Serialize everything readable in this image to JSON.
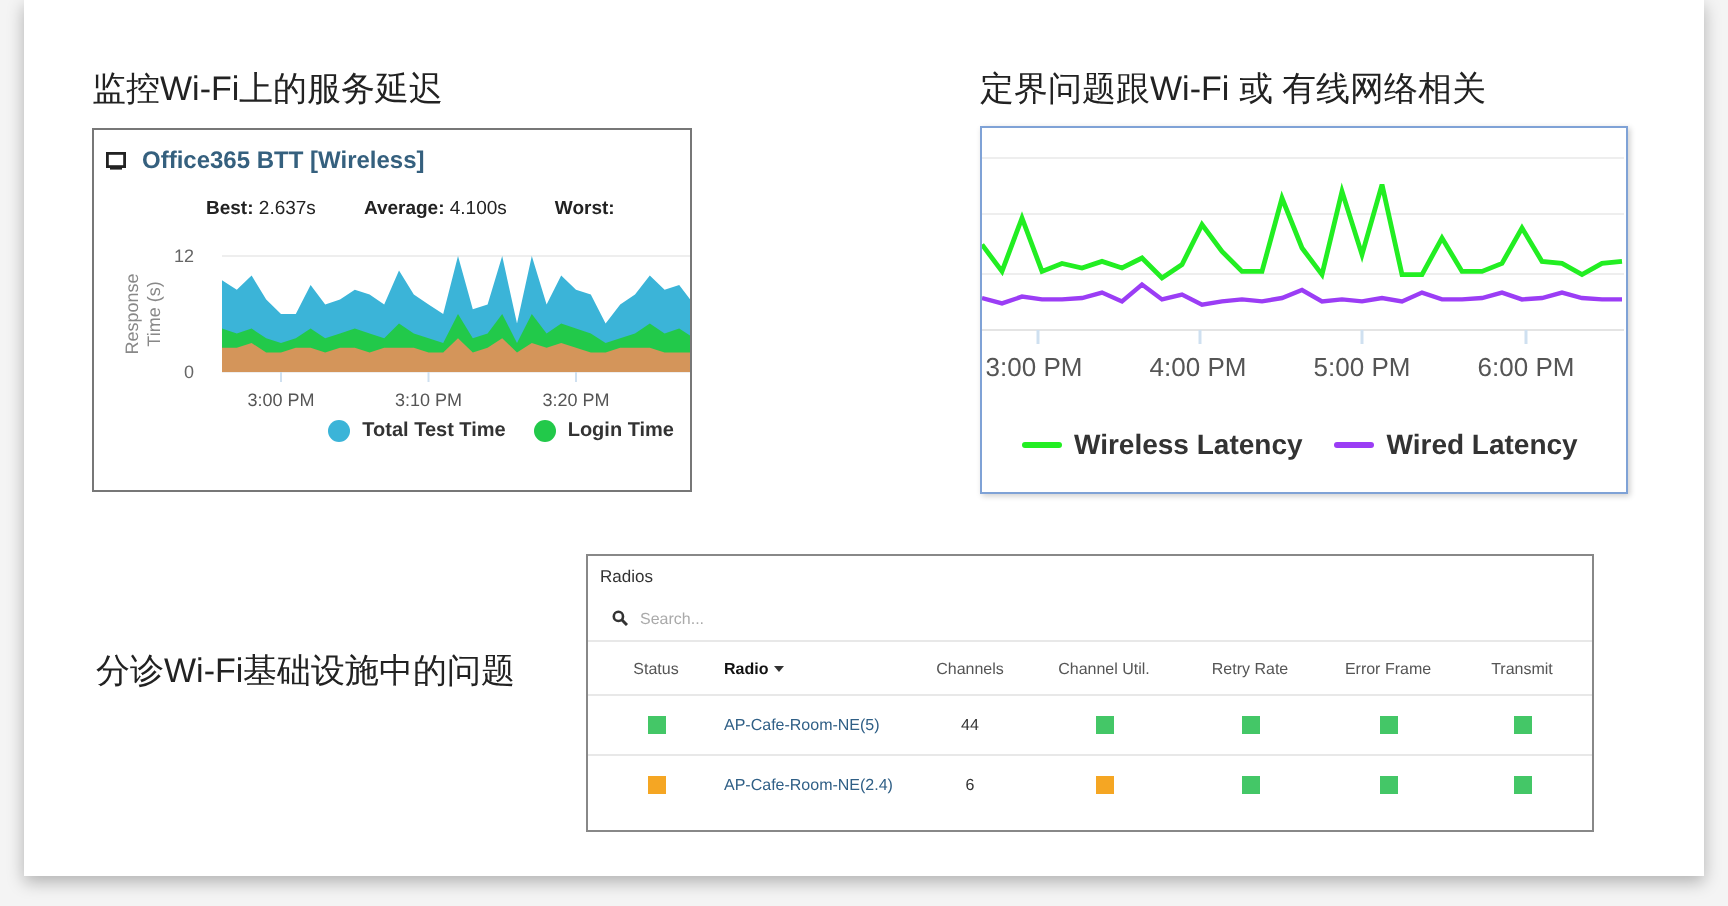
{
  "left_section": {
    "heading": "监控Wi-Fi上的服务延迟",
    "panel": {
      "title": "Office365 BTT [Wireless]",
      "stats": [
        "**Best:** 2.637s",
        "**Average:** 4.100s",
        "**Worst:**"
      ],
      "chart_data": {
        "type": "area",
        "ylabel": "Response Time (s)",
        "categories": [
          null,
          null,
          null,
          null,
          "3:00 PM",
          null,
          null,
          null,
          null,
          null,
          null,
          null,
          null,
          null,
          "3:10 PM",
          null,
          null,
          null,
          null,
          null,
          null,
          null,
          null,
          null,
          "3:20 PM",
          null,
          null,
          null,
          null,
          null,
          null,
          null,
          null
        ],
        "ylim": [
          0,
          12
        ],
        "yticks": [
          0,
          12
        ],
        "series": [
          {
            "name": "Total Test Time",
            "color": "#3bb4d8",
            "values": [
              9.5,
              8.5,
              10,
              7.5,
              6,
              6,
              9,
              7,
              7.5,
              8.5,
              8,
              7,
              10.5,
              8,
              7,
              6,
              12,
              6.5,
              7,
              12,
              5,
              12,
              7,
              10,
              8.5,
              8,
              5,
              7,
              8,
              10,
              8.5,
              9,
              7
            ]
          },
          {
            "name": "Login Time",
            "color": "#22c94a",
            "values": [
              4.5,
              4,
              4.5,
              3.5,
              3,
              3.5,
              4.5,
              3.5,
              4,
              4.5,
              4,
              3.5,
              5,
              4,
              3.5,
              3,
              6,
              3.5,
              4,
              6,
              3,
              6,
              4,
              5,
              4.5,
              4,
              3,
              3.5,
              4,
              5,
              4,
              4.5,
              3.5
            ]
          },
          {
            "color": "#d4955a",
            "values": [
              2.5,
              2.5,
              3,
              2,
              2,
              2.5,
              2.5,
              2,
              2.5,
              2.5,
              2,
              2.5,
              2.5,
              2.5,
              2,
              2,
              3.5,
              2,
              2.5,
              3.5,
              2,
              3,
              2.5,
              3,
              2.5,
              2,
              2,
              2.5,
              2.5,
              2.5,
              2,
              2,
              2
            ]
          }
        ]
      }
    }
  },
  "right_section": {
    "heading": "定界问题跟Wi-Fi 或 有线网络相关",
    "panel": {
      "x_labels": [
        "3:00 PM",
        "4:00 PM",
        "5:00 PM",
        "6:00 PM"
      ],
      "legend": [
        {
          "label": "Wireless Latency",
          "color": "#22ee22"
        },
        {
          "label": "Wired Latency",
          "color": "#9b3df5"
        }
      ]
    }
  },
  "bottom_section": {
    "heading": "分诊Wi-Fi基础设施中的问题",
    "table": {
      "title": "Radios",
      "search": {
        "placeholder": "Search..."
      },
      "columns": [
        "Status",
        "Radio",
        "Channels",
        "Channel Util.",
        "Retry Rate",
        "Error Frame",
        "Transmit"
      ],
      "rows": [
        {
          "cells": [
            {
              "kind": "square",
              "color": "#44c767"
            },
            {
              "kind": "link",
              "text": "AP-Cafe-Room-NE(5)"
            },
            {
              "kind": "text",
              "text": "44"
            },
            {
              "kind": "square",
              "color": "#44c767"
            },
            {
              "kind": "square",
              "color": "#44c767"
            },
            {
              "kind": "square",
              "color": "#44c767"
            },
            {
              "kind": "square",
              "color": "#44c767"
            }
          ]
        },
        {
          "cells": [
            {
              "kind": "square",
              "color": "#f5a623"
            },
            {
              "kind": "link",
              "text": "AP-Cafe-Room-NE(2.4)"
            },
            {
              "kind": "text",
              "text": "6"
            },
            {
              "kind": "square",
              "color": "#f5a623"
            },
            {
              "kind": "square",
              "color": "#44c767"
            },
            {
              "kind": "square",
              "color": "#44c767"
            },
            {
              "kind": "square",
              "color": "#44c767"
            }
          ]
        }
      ]
    }
  }
}
